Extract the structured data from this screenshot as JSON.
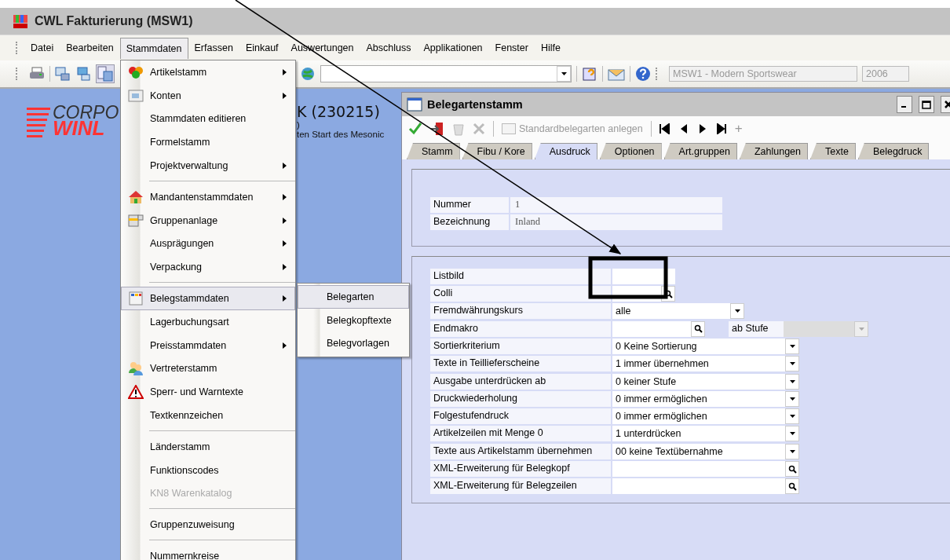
{
  "app": {
    "title": "CWL Fakturierung (MSW1)"
  },
  "menu_bar": [
    {
      "label": "Datei",
      "selected": false
    },
    {
      "label": "Bearbeiten",
      "selected": false
    },
    {
      "label": "Stammdaten",
      "selected": true
    },
    {
      "label": "Erfassen",
      "selected": false
    },
    {
      "label": "Einkauf",
      "selected": false
    },
    {
      "label": "Auswertungen",
      "selected": false
    },
    {
      "label": "Abschluss",
      "selected": false
    },
    {
      "label": "Applikationen",
      "selected": false
    },
    {
      "label": "Fenster",
      "selected": false
    },
    {
      "label": "Hilfe",
      "selected": false
    }
  ],
  "toolbar": {
    "company": "MSW1 - Modern Sportswear",
    "year": "2006"
  },
  "desktop": {
    "logo_top": "CORPO",
    "logo_bottom": "WINL",
    "heading": "K (230215)",
    "line_2": ")",
    "line_3": "ten Start des Mesonic"
  },
  "dropdown_menu": [
    {
      "label": "Artikelstamm",
      "kind": "articles",
      "submenu": true,
      "disabled": false,
      "selected": false,
      "separator_before": false
    },
    {
      "label": "Konten",
      "kind": "accounts",
      "submenu": true,
      "disabled": false,
      "selected": false,
      "separator_before": false
    },
    {
      "label": "Stammdaten editieren",
      "kind": "plain",
      "submenu": false,
      "disabled": false,
      "selected": false,
      "separator_before": false
    },
    {
      "label": "Formelstamm",
      "kind": "plain",
      "submenu": false,
      "disabled": false,
      "selected": false,
      "separator_before": false
    },
    {
      "label": "Projektverwaltung",
      "kind": "plain",
      "submenu": true,
      "disabled": false,
      "selected": false,
      "separator_before": false
    },
    {
      "label": "Mandantenstammdaten",
      "kind": "clients",
      "submenu": true,
      "disabled": false,
      "selected": false,
      "separator_before": true
    },
    {
      "label": "Gruppenanlage",
      "kind": "groups",
      "submenu": true,
      "disabled": false,
      "selected": false,
      "separator_before": false
    },
    {
      "label": "Ausprägungen",
      "kind": "plain",
      "submenu": true,
      "disabled": false,
      "selected": false,
      "separator_before": false
    },
    {
      "label": "Verpackung",
      "kind": "plain",
      "submenu": true,
      "disabled": false,
      "selected": false,
      "separator_before": false
    },
    {
      "label": "Belegstammdaten",
      "kind": "documents",
      "submenu": true,
      "disabled": false,
      "selected": true,
      "separator_before": true
    },
    {
      "label": "Lagerbuchungsart",
      "kind": "plain",
      "submenu": false,
      "disabled": false,
      "selected": false,
      "separator_before": false
    },
    {
      "label": "Preisstammdaten",
      "kind": "plain",
      "submenu": true,
      "disabled": false,
      "selected": false,
      "separator_before": false
    },
    {
      "label": "Vertreterstamm",
      "kind": "agents",
      "submenu": false,
      "disabled": false,
      "selected": false,
      "separator_before": false
    },
    {
      "label": "Sperr- und Warntexte",
      "kind": "warning",
      "submenu": false,
      "disabled": false,
      "selected": false,
      "separator_before": false
    },
    {
      "label": "Textkennzeichen",
      "kind": "plain",
      "submenu": false,
      "disabled": false,
      "selected": false,
      "separator_before": false
    },
    {
      "label": "Länderstamm",
      "kind": "plain",
      "submenu": false,
      "disabled": false,
      "selected": false,
      "separator_before": true
    },
    {
      "label": "Funktionscodes",
      "kind": "plain",
      "submenu": false,
      "disabled": false,
      "selected": false,
      "separator_before": false
    },
    {
      "label": "KN8 Warenkatalog",
      "kind": "plain",
      "submenu": false,
      "disabled": true,
      "selected": false,
      "separator_before": false
    },
    {
      "label": "Gruppenzuweisung",
      "kind": "plain",
      "submenu": false,
      "disabled": false,
      "selected": false,
      "separator_before": true
    },
    {
      "label": "Nummernkreise",
      "kind": "plain",
      "submenu": false,
      "disabled": false,
      "selected": false,
      "separator_before": true
    }
  ],
  "submenu": [
    {
      "label": "Belegarten",
      "selected": true
    },
    {
      "label": "Belegkopftexte",
      "selected": false
    },
    {
      "label": "Belegvorlagen",
      "selected": false
    }
  ],
  "window": {
    "title": "Belegartenstamm",
    "toolbar": {
      "create_label": "Standardbelegarten anlegen",
      "add": "+"
    },
    "tabs": [
      {
        "label": "Stamm",
        "selected": false
      },
      {
        "label": "Fibu / Kore",
        "selected": false
      },
      {
        "label": "Ausdruck",
        "selected": true
      },
      {
        "label": "Optionen",
        "selected": false
      },
      {
        "label": "Art.gruppen",
        "selected": false
      },
      {
        "label": "Zahlungen",
        "selected": false
      },
      {
        "label": "Texte",
        "selected": false
      },
      {
        "label": "Belegdruck",
        "selected": false
      }
    ],
    "header_fields": [
      {
        "label": "Nummer",
        "value": "1"
      },
      {
        "label": "Bezeichnung",
        "value": "Inland"
      }
    ],
    "fields": [
      {
        "label": "Listbild",
        "kind": "short-field"
      },
      {
        "label": "Colli",
        "kind": "short-lookup"
      },
      {
        "label": "Fremdwährungskurs",
        "kind": "mid-select",
        "value": "alle"
      },
      {
        "label": "Endmakro",
        "kind": "level-lookup",
        "level_label": "ab Stufe"
      },
      {
        "label": "Sortierkriterium",
        "kind": "select",
        "value": "0 Keine Sortierung"
      },
      {
        "label": "Texte in Teillieferscheine",
        "kind": "select",
        "value": "1 immer übernehmen"
      },
      {
        "label": "Ausgabe unterdrücken ab",
        "kind": "select",
        "value": "0 keiner Stufe"
      },
      {
        "label": "Druckwiederholung",
        "kind": "select",
        "value": "0 immer ermöglichen"
      },
      {
        "label": "Folgestufendruck",
        "kind": "select",
        "value": "0 immer ermöglichen"
      },
      {
        "label": "Artikelzeilen mit Menge 0",
        "kind": "select",
        "value": "1 unterdrücken"
      },
      {
        "label": "Texte aus Artikelstamm übernehmen",
        "kind": "select",
        "value": "00  keine Textübernahme"
      },
      {
        "label": "XML-Erweiterung für Belegkopf",
        "kind": "lookup"
      },
      {
        "label": "XML-Erweiterung für Belegzeilen",
        "kind": "lookup"
      }
    ]
  }
}
